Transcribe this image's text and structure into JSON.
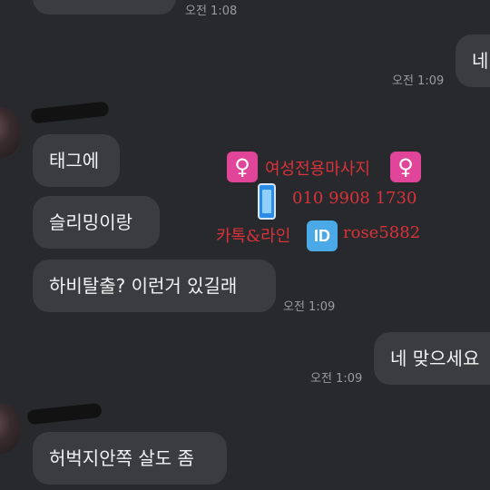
{
  "messages": {
    "m0": {
      "time": "오전 1:08"
    },
    "m1": {
      "text": "네",
      "time": "오전 1:09"
    },
    "m2": {
      "text": "태그에"
    },
    "m3": {
      "text": "슬리밍이랑"
    },
    "m4": {
      "text": "하비탈출? 이런거 있길래",
      "time": "오전 1:09"
    },
    "m5": {
      "text": "네 맞으세요",
      "time": "오전 1:09"
    },
    "m6": {
      "text": "허벅지안쪽 살도 좀"
    }
  },
  "overlay": {
    "line1": "여성전용마사지",
    "line2": "010 9908 1730",
    "line3_prefix": "카톡&라인",
    "id_badge": "ID",
    "line3_id": "rose5882",
    "female_symbol": "♀"
  },
  "icons": [
    "female-sign-icon",
    "mobile-phone-icon",
    "id-badge-icon"
  ],
  "colors": {
    "background": "#28292d",
    "bubble": "#3b3c40",
    "overlay_text": "#d8323a",
    "female_badge": "#e0459a",
    "id_badge": "#4aa9e6"
  }
}
